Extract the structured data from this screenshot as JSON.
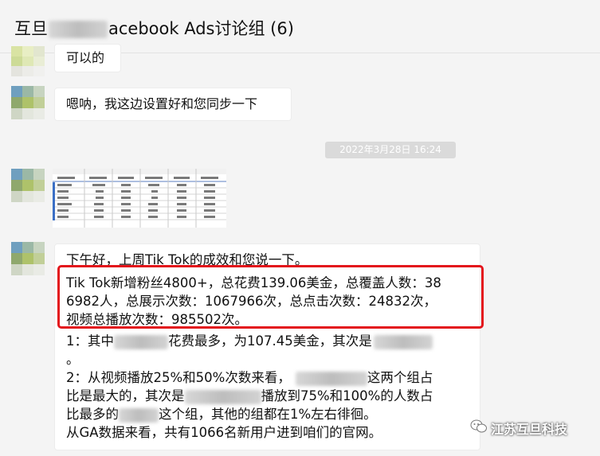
{
  "header": {
    "title_prefix": "互旦",
    "title_suffix": "acebook Ads讨论组 (6)"
  },
  "messages": [
    {
      "text": "可以的"
    },
    {
      "text": "嗯呐，我这边设置好和您同步一下"
    }
  ],
  "timestamp": "2022年3月28日 16:24",
  "report": {
    "line1": "下午好，上周Tik Tok的成效和您说一下。",
    "line2": "Tik Tok新增粉丝4800+，总花费139.06美金，总覆盖人数：38",
    "line3": "6982人，总展示次数：1067966次，总点击次数：24832次，",
    "line4": "视频总播放次数：985502次。",
    "line5a": "1：其中",
    "line5b": "花费最多，为107.45美金，其次是",
    "line6": "。",
    "line7a": "2：从视频播放25%和50%次数来看，",
    "line7b": "这两个组占",
    "line8a": "比是最大的，其次是",
    "line8b": "播放到75%和100%的人数占",
    "line9a": "比最多的",
    "line9b": "这个组，其他的组都在1%左右徘徊。",
    "line10": "从GA数据来看，共有1066名新用户进到咱们的官网。"
  },
  "watermark": {
    "label": "江苏互旦科技"
  },
  "colors": {
    "highlight_border": "#e3141b",
    "background": "#f4f4f4"
  }
}
